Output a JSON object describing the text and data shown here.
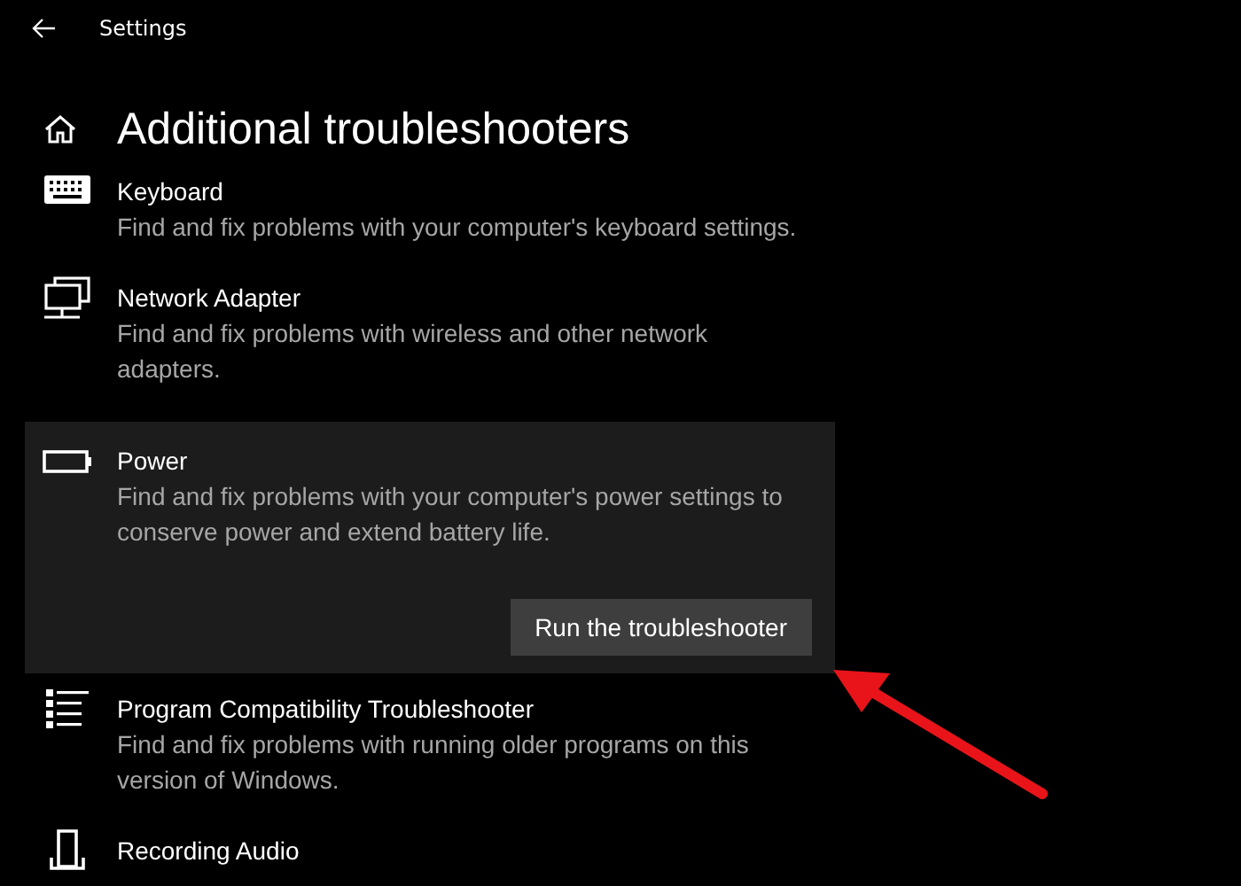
{
  "window": {
    "title": "Settings"
  },
  "page": {
    "title": "Additional troubleshooters"
  },
  "troubleshooters": [
    {
      "name": "Keyboard",
      "description": "Find and fix problems with your computer's keyboard settings.",
      "expanded": false
    },
    {
      "name": "Network Adapter",
      "description": "Find and fix problems with wireless and other network adapters.",
      "expanded": false
    },
    {
      "name": "Power",
      "description": "Find and fix problems with your computer's power settings to conserve power and extend battery life.",
      "expanded": true,
      "button": "Run the troubleshooter"
    },
    {
      "name": "Program Compatibility Troubleshooter",
      "description": "Find and fix problems with running older programs on this version of Windows.",
      "expanded": false
    },
    {
      "name": "Recording Audio",
      "expanded": false
    }
  ]
}
